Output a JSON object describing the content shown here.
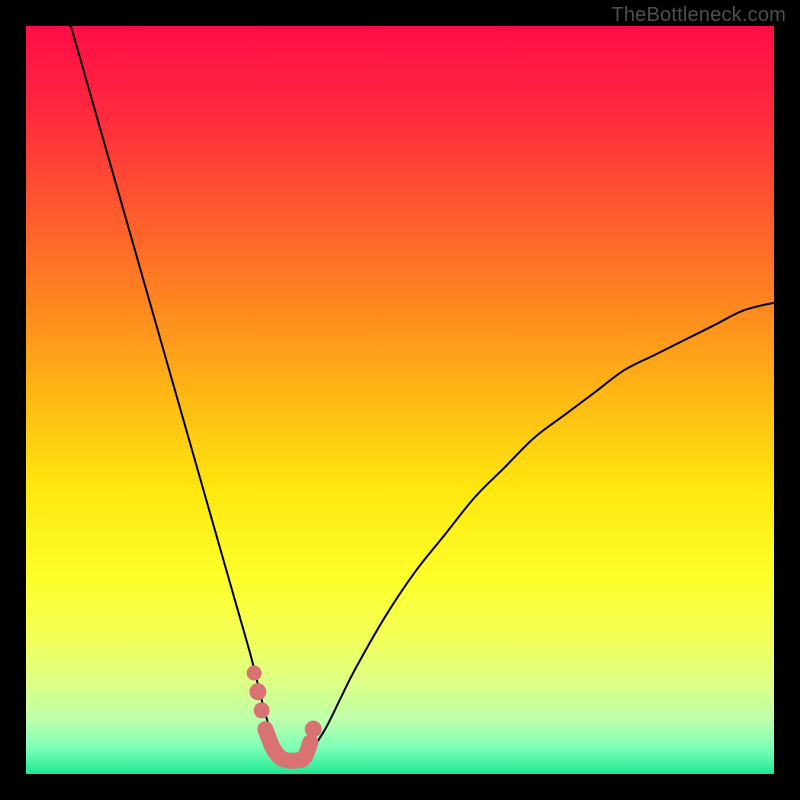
{
  "watermark": "TheBottleneck.com",
  "chart_data": {
    "type": "line",
    "title": "",
    "xlabel": "",
    "ylabel": "",
    "xlim": [
      0,
      100
    ],
    "ylim": [
      0,
      100
    ],
    "series": [
      {
        "name": "bottleneck-curve",
        "color": "#000000",
        "x": [
          6,
          8,
          10,
          12,
          14,
          16,
          18,
          20,
          22,
          24,
          26,
          28,
          30,
          31,
          32,
          33,
          34,
          35,
          36,
          37,
          38,
          40,
          42,
          44,
          48,
          52,
          56,
          60,
          64,
          68,
          72,
          76,
          80,
          84,
          88,
          92,
          96,
          100
        ],
        "y": [
          100,
          93,
          86,
          79,
          72,
          65,
          58,
          51,
          44,
          37,
          30,
          23,
          16,
          12,
          8,
          5,
          3,
          2,
          2,
          2,
          3,
          6,
          10,
          14,
          21,
          27,
          32,
          37,
          41,
          45,
          48,
          51,
          54,
          56,
          58,
          60,
          62,
          63
        ]
      },
      {
        "name": "highlight-dip",
        "color": "#d97373",
        "x": [
          30.5,
          31.0,
          31.5,
          32.0,
          33.0,
          34.0,
          35.0,
          36.0,
          37.0,
          37.5,
          38.0,
          38.4
        ],
        "y": [
          13.5,
          11.0,
          8.5,
          6.0,
          3.5,
          2.2,
          1.8,
          1.8,
          2.0,
          2.8,
          4.2,
          6.0
        ]
      }
    ],
    "gradient_bands": [
      {
        "stop": 0.0,
        "color": "#ff0d47"
      },
      {
        "stop": 0.12,
        "color": "#ff2a3e"
      },
      {
        "stop": 0.25,
        "color": "#ff5a2e"
      },
      {
        "stop": 0.38,
        "color": "#ff8a1f"
      },
      {
        "stop": 0.5,
        "color": "#ffba14"
      },
      {
        "stop": 0.62,
        "color": "#ffe80f"
      },
      {
        "stop": 0.74,
        "color": "#fdff2b"
      },
      {
        "stop": 0.82,
        "color": "#f2ff5a"
      },
      {
        "stop": 0.88,
        "color": "#ddff88"
      },
      {
        "stop": 0.93,
        "color": "#baffad"
      },
      {
        "stop": 0.965,
        "color": "#7dffb8"
      },
      {
        "stop": 1.0,
        "color": "#1fe893"
      }
    ]
  }
}
